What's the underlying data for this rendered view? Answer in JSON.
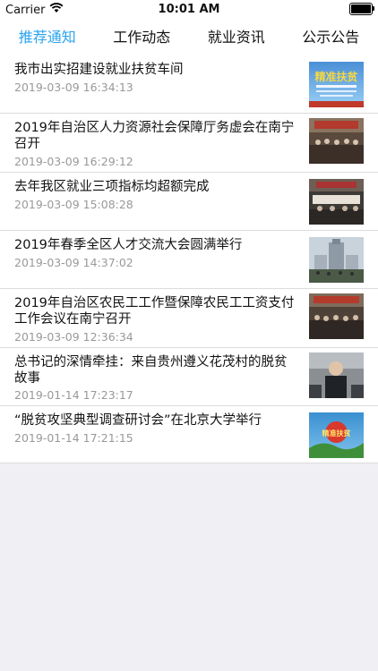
{
  "status_bar": {
    "carrier": "Carrier",
    "time": "10:01 AM",
    "icons": [
      "wifi-icon",
      "battery-icon"
    ]
  },
  "tabs": [
    {
      "label": "推荐通知",
      "active": true
    },
    {
      "label": "工作动态",
      "active": false
    },
    {
      "label": "就业资讯",
      "active": false
    },
    {
      "label": "公示公告",
      "active": false
    }
  ],
  "colors": {
    "accent": "#2aa3ee",
    "timestamp": "#999999",
    "background": "#efeff4"
  },
  "news": [
    {
      "title": "我市出实招建设就业扶贫车间",
      "time": "2019-03-09 16:34:13",
      "thumb_text": "精准扶贫"
    },
    {
      "title": "2019年自治区人力资源社会保障厅务虚会在南宁召开",
      "time": "2019-03-09 16:29:12"
    },
    {
      "title": "去年我区就业三项指标均超额完成",
      "time": "2019-03-09 15:08:28"
    },
    {
      "title": "2019年春季全区人才交流大会圆满举行",
      "time": "2019-03-09 14:37:02"
    },
    {
      "title": "2019年自治区农民工工作暨保障农民工工资支付工作会议在南宁召开",
      "time": "2019-03-09 12:36:34"
    },
    {
      "title": "总书记的深情牵挂：来自贵州遵义花茂村的脱贫故事",
      "time": "2019-01-14 17:23:17"
    },
    {
      "title": "“脱贫攻坚典型调查研讨会”在北京大学举行",
      "time": "2019-01-14 17:21:15",
      "thumb_text": "精准扶贫"
    }
  ]
}
